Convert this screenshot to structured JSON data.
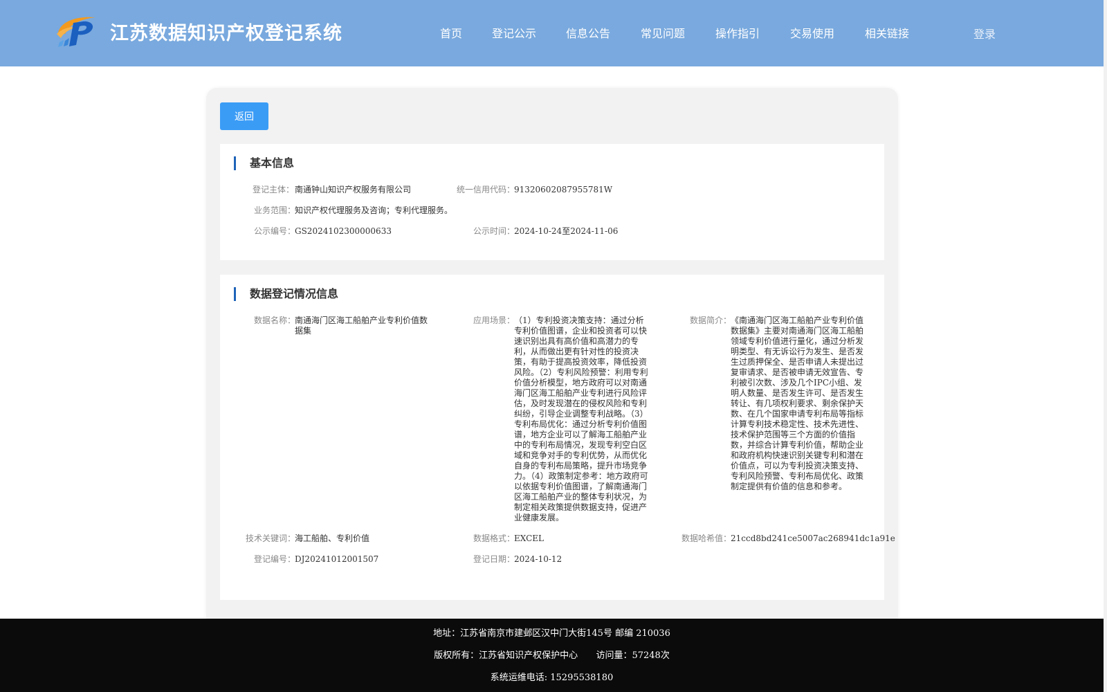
{
  "header": {
    "site_title": "江苏数据知识产权登记系统",
    "brand_colors": {
      "header_bg": "#79a9de",
      "logo_orange": "#f39a1e",
      "logo_blue": "#1b5fbf"
    },
    "nav": [
      "首页",
      "登记公示",
      "信息公告",
      "常见问题",
      "操作指引",
      "交易使用",
      "相关链接"
    ],
    "login_label": "登录"
  },
  "back_label": "返回",
  "basic_info": {
    "title": "基本信息",
    "subject": {
      "label": "登记主体：",
      "value": "南通钟山知识产权服务有限公司"
    },
    "credit_code": {
      "label": "统一信用代码：",
      "value": "91320602087955781W"
    },
    "business_scope": {
      "label": "业务范围：",
      "value": "知识产权代理服务及咨询；专利代理服务。"
    },
    "notice_no": {
      "label": "公示编号：",
      "value": "GS2024102300000633"
    },
    "notice_time": {
      "label": "公示时间：",
      "value": "2024-10-24至2024-11-06"
    }
  },
  "registration": {
    "title": "数据登记情况信息",
    "data_name": {
      "label": "数据名称：",
      "value": "南通海门区海工船舶产业专利价值数据集"
    },
    "scenario": {
      "label": "应用场景：",
      "value": "（1）专利投资决策支持：通过分析专利价值图谱，企业和投资者可以快速识别出具有高价值和高潜力的专利，从而做出更有针对性的投资决策，有助于提高投资效率，降低投资风险。（2）专利风险预警：利用专利价值分析模型，地方政府可以对南通海门区海工船舶产业专利进行风险评估，及时发现潜在的侵权风险和专利纠纷，引导企业调整专利战略。（3）专利布局优化：通过分析专利价值图谱，地方企业可以了解海工船舶产业中的专利布局情况，发现专利空白区域和竞争对手的专利优势，从而优化自身的专利布局策略，提升市场竞争力。（4）政策制定参考：地方政府可以依据专利价值图谱，了解南通海门区海工船舶产业的整体专利状况，为制定相关政策提供数据支持，促进产业健康发展。"
    },
    "summary": {
      "label": "数据简介：",
      "value": "《南通海门区海工船舶产业专利价值数据集》主要对南通海门区海工船舶领域专利价值进行量化，通过分析发明类型、有无诉讼行为发生、是否发生过质押保全、是否申请人未提出过复审请求、是否被申请无效宣告、专利被引次数、涉及几个IPC小组、发明人数量、是否发生许可、是否发生转让、有几项权利要求、剩余保护天数、在几个国家申请专利布局等指标计算专利技术稳定性、技术先进性、技术保护范围等三个方面的价值指数，并综合计算专利价值，帮助企业和政府机构快速识别关键专利和潜在价值点，可以为专利投资决策支持、专利风险预警、专利布局优化、政策制定提供有价值的信息和参考。"
    },
    "keywords": {
      "label": "技术关键词：",
      "value": "海工船舶、专利价值"
    },
    "format": {
      "label": "数据格式：",
      "value": "EXCEL"
    },
    "hash": {
      "label": "数据哈希值：",
      "value": "21ccd8bd241ce5007ac268941dc1a91e"
    },
    "reg_no": {
      "label": "登记编号：",
      "value": "DJ20241012001507"
    },
    "reg_date": {
      "label": "登记日期：",
      "value": "2024-10-12"
    }
  },
  "footer": {
    "address": "地址：江苏省南京市建邺区汉中门大街145号 邮编 210036",
    "copyright": "版权所有：江苏省知识产权保护中心",
    "visits": "访问量：57248次",
    "support_phone": "系统运维电话: 15295538180"
  }
}
